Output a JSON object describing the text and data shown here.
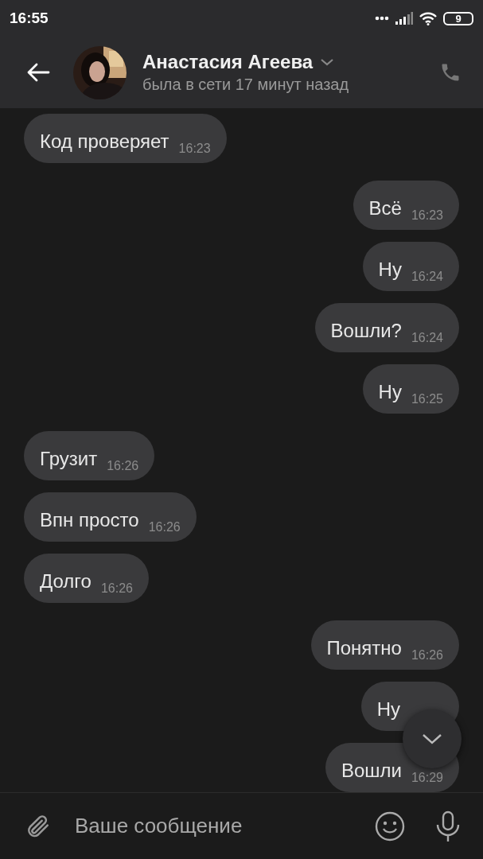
{
  "status_bar": {
    "time": "16:55",
    "battery": "9"
  },
  "header": {
    "name": "Анастасия Агеева",
    "status": "была в сети 17 минут назад"
  },
  "messages": [
    {
      "text": "Код проверяет",
      "time": "16:23",
      "kind": "incoming"
    },
    {
      "text": "Всё",
      "time": "16:23",
      "kind": "outgoing"
    },
    {
      "text": "Ну",
      "time": "16:24",
      "kind": "outgoing"
    },
    {
      "text": "Вошли?",
      "time": "16:24",
      "kind": "outgoing"
    },
    {
      "text": "Ну",
      "time": "16:25",
      "kind": "outgoing"
    },
    {
      "text": "Грузит",
      "time": "16:26",
      "kind": "incoming"
    },
    {
      "text": "Впн просто",
      "time": "16:26",
      "kind": "incoming"
    },
    {
      "text": "Долго",
      "time": "16:26",
      "kind": "incoming"
    },
    {
      "text": "Понятно",
      "time": "16:26",
      "kind": "outgoing"
    },
    {
      "text": "Ну",
      "kind": "outgoing"
    },
    {
      "text": "Вошли",
      "time": "16:29",
      "kind": "outgoing"
    }
  ],
  "composer": {
    "placeholder": "Ваше сообщение"
  }
}
